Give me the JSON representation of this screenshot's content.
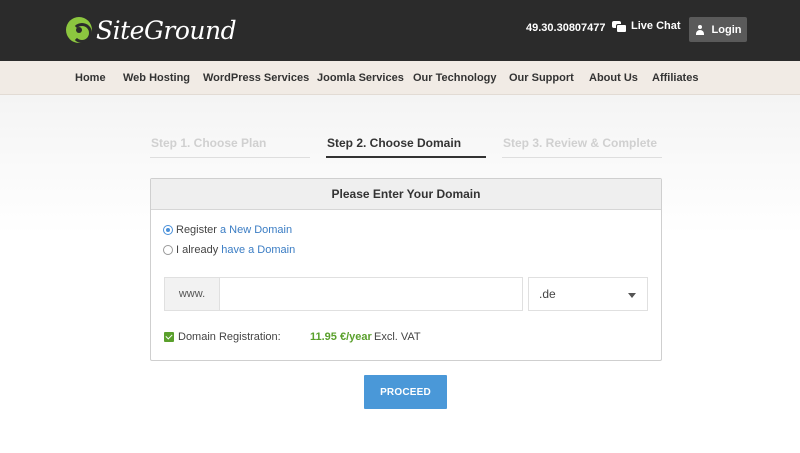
{
  "header": {
    "logo_text": "SiteGround",
    "phone": "49.30.30807477",
    "live_chat_label": "Live Chat",
    "login_label": "Login",
    "background_color": "#2b2b2b",
    "logo_mark_color": "#8cc63f"
  },
  "nav": {
    "items": [
      {
        "label": "Home"
      },
      {
        "label": "Web Hosting"
      },
      {
        "label": "WordPress Services"
      },
      {
        "label": "Joomla Services"
      },
      {
        "label": "Our Technology"
      },
      {
        "label": "Our Support"
      },
      {
        "label": "About Us"
      },
      {
        "label": "Affiliates"
      }
    ]
  },
  "steps": [
    {
      "label": "Step 1. Choose Plan",
      "state": "inactive"
    },
    {
      "label": "Step 2. Choose Domain",
      "state": "active"
    },
    {
      "label": "Step 3. Review & Complete",
      "state": "inactive"
    }
  ],
  "panel": {
    "title": "Please Enter Your Domain",
    "options": [
      {
        "prefix": "Register",
        "link": "a New Domain",
        "checked": true
      },
      {
        "prefix": "I already",
        "link": "have a Domain",
        "checked": false
      }
    ],
    "www_prefix": "www.",
    "domain_value": "",
    "domain_placeholder": "",
    "tld_selected": ".de",
    "registration_label": "Domain Registration:",
    "registration_price": "11.95 €/year",
    "registration_note": "Excl. VAT",
    "registration_checked": true
  },
  "proceed_label": "PROCEED",
  "colors": {
    "accent_blue": "#4a98d8",
    "price_green": "#5aa02c",
    "link_blue": "#3b7dc4"
  }
}
